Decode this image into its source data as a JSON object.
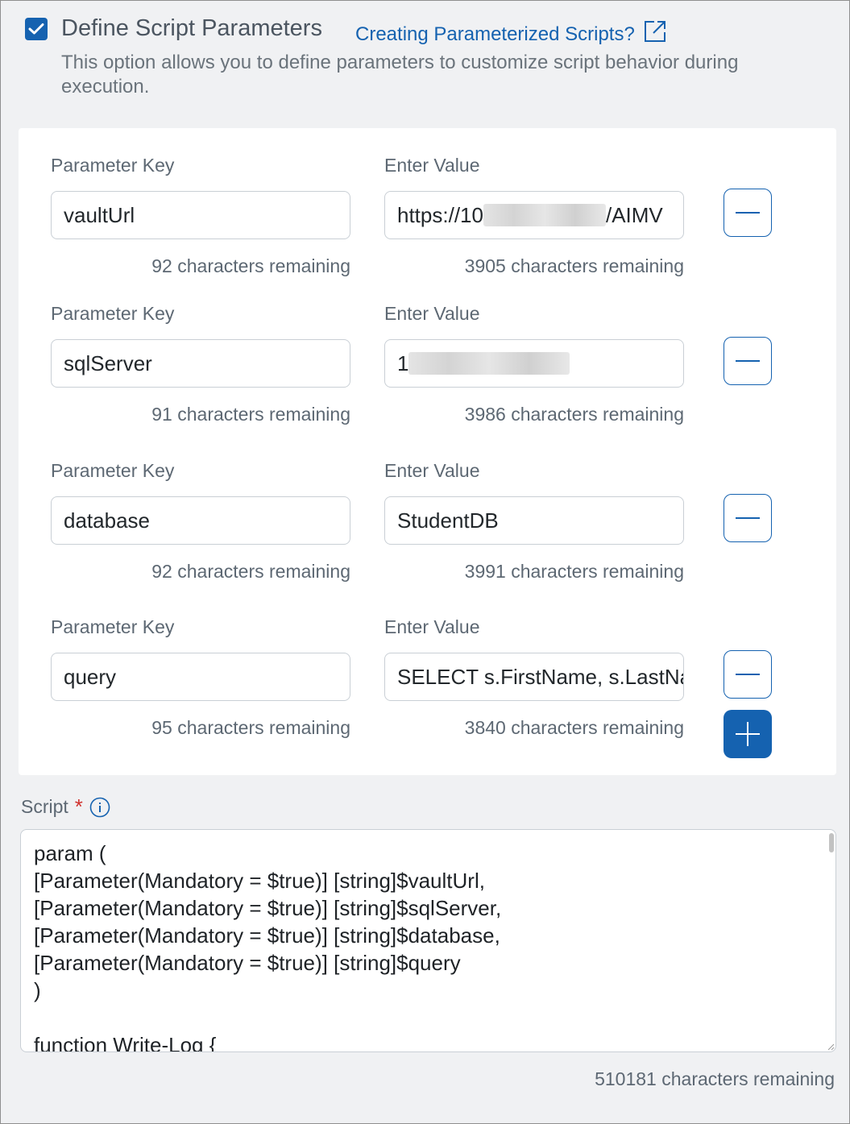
{
  "option": {
    "checked": true,
    "title": "Define Script Parameters",
    "help_link": "Creating Parameterized Scripts?",
    "description": "This option allows you to define parameters to customize script behavior during execution."
  },
  "labels": {
    "key_label": "Parameter Key",
    "value_label": "Enter Value"
  },
  "parameters": [
    {
      "key_label": "Parameter Key",
      "value_label": "Enter Value",
      "key": "vaultUrl",
      "value_prefix": "https://10",
      "value_suffix": "/AIMV",
      "key_remaining": "92 characters remaining",
      "value_remaining": "3905 characters remaining"
    },
    {
      "key_label": "Parameter Key",
      "value_label": "Enter Value",
      "key": "sqlServer",
      "value_prefix": "1",
      "value_suffix": "",
      "key_remaining": "91 characters remaining",
      "value_remaining": "3986 characters remaining"
    },
    {
      "key_label": "Parameter Key",
      "value_label": "Enter Value",
      "key": "database",
      "value_prefix": "StudentDB",
      "value_suffix": "",
      "key_remaining": "92 characters remaining",
      "value_remaining": "3991 characters remaining"
    },
    {
      "key_label": "Parameter Key",
      "value_label": "Enter Value",
      "key": "query",
      "value_prefix": "SELECT s.FirstName, s.LastName",
      "value_suffix": "",
      "key_remaining": "95 characters remaining",
      "value_remaining": "3840 characters remaining"
    }
  ],
  "script": {
    "label": "Script",
    "required_mark": "*",
    "content": "param (\n[Parameter(Mandatory = $true)] [string]$vaultUrl,\n[Parameter(Mandatory = $true)] [string]$sqlServer,\n[Parameter(Mandatory = $true)] [string]$database,\n[Parameter(Mandatory = $true)] [string]$query\n)\n\nfunction Write-Log {",
    "remaining": "510181 characters remaining"
  },
  "colors": {
    "accent": "#1562b0",
    "required": "#d0312d",
    "background": "#f0f1f3",
    "card": "#ffffff"
  },
  "icons": {
    "checkbox": "checkmark-icon",
    "external": "external-link-icon",
    "remove": "minus-icon",
    "add": "plus-icon",
    "info": "info-icon"
  }
}
